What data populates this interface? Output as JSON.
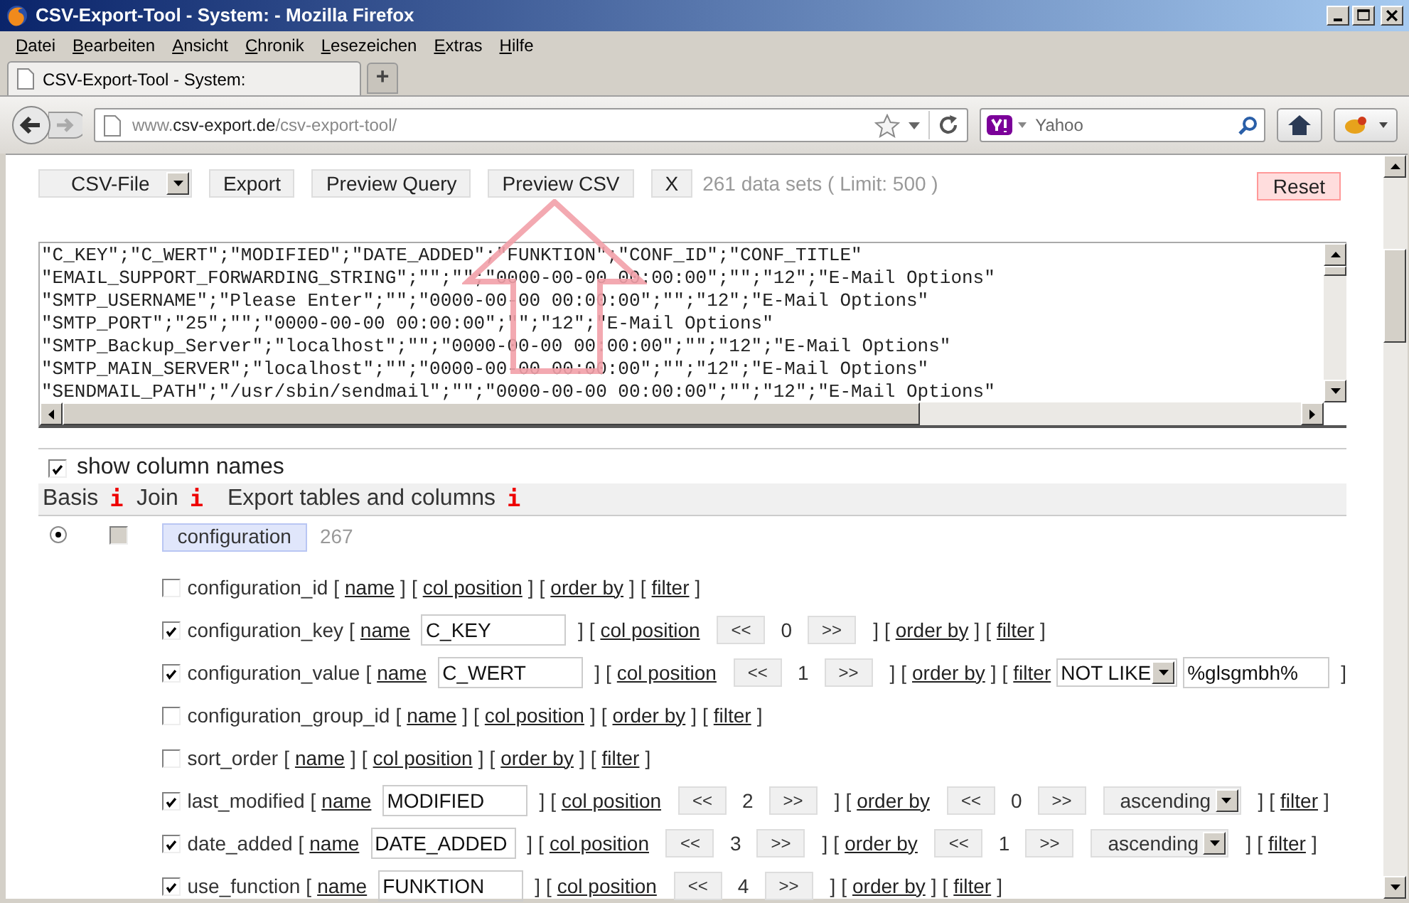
{
  "window": {
    "title": "CSV-Export-Tool - System: - Mozilla Firefox"
  },
  "menu": [
    "Datei",
    "Bearbeiten",
    "Ansicht",
    "Chronik",
    "Lesezeichen",
    "Extras",
    "Hilfe"
  ],
  "tabs": [
    {
      "label": "CSV-Export-Tool - System:",
      "selected": true
    }
  ],
  "new_tab": "+",
  "address": {
    "prefix": "www.",
    "domain": "csv-export.de",
    "path": "/csv-export-tool/"
  },
  "search": {
    "placeholder": "Yahoo"
  },
  "toolbar": {
    "format": "CSV-File",
    "buttons": [
      "Export",
      "Preview Query",
      "Preview CSV",
      "X"
    ],
    "info": "261 data sets ( Limit: 500 )",
    "reset": "Reset"
  },
  "preview": {
    "lines": [
      "\"C_KEY\";\"C_WERT\";\"MODIFIED\";\"DATE_ADDED\";\"FUNKTION\";\"CONF_ID\";\"CONF_TITLE\"",
      "\"EMAIL_SUPPORT_FORWARDING_STRING\";\"\";\"\";\"0000-00-00 00:00:00\";\"\";\"12\";\"E-Mail Options\"",
      "\"SMTP_USERNAME\";\"Please Enter\";\"\";\"0000-00-00 00:00:00\";\"\";\"12\";\"E-Mail Options\"",
      "\"SMTP_PORT\";\"25\";\"\";\"0000-00-00 00:00:00\";\"\";\"12\";\"E-Mail Options\"",
      "\"SMTP_Backup_Server\";\"localhost\";\"\";\"0000-00-00 00:00:00\";\"\";\"12\";\"E-Mail Options\"",
      "\"SMTP_MAIN_SERVER\";\"localhost\";\"\";\"0000-00-00 00:00:00\";\"\";\"12\";\"E-Mail Options\"",
      "\"SENDMAIL_PATH\";\"/usr/sbin/sendmail\";\"\";\"0000-00-00 00:00:00\";\"\";\"12\";\"E-Mail Options\""
    ]
  },
  "show_column_names": {
    "label": "show column names",
    "checked": true
  },
  "headers": [
    {
      "label": "Basis",
      "info": "i"
    },
    {
      "label": "Join",
      "info": "i"
    },
    {
      "label": "Export tables and columns",
      "info": "i"
    }
  ],
  "tables": [
    {
      "name": "configuration",
      "count": "267",
      "basis": {
        "selected": true
      },
      "join": {
        "checked": false,
        "disabled": true
      },
      "columns": [
        {
          "name": "configuration_id",
          "checked": false,
          "parts": [
            {
              "kind": "name",
              "open": "[",
              "link": "name",
              "close": "]"
            },
            {
              "kind": "col_position",
              "open": "[",
              "link": "col position",
              "close": "]"
            },
            {
              "kind": "order_by",
              "open": "[",
              "link": "order by",
              "close": "]"
            },
            {
              "kind": "filter",
              "open": "[",
              "link": "filter",
              "close": "]"
            }
          ]
        },
        {
          "name": "configuration_key",
          "checked": true,
          "parts": [
            {
              "kind": "name",
              "open": "[",
              "link": "name",
              "value": "C_KEY",
              "close": "]"
            },
            {
              "kind": "col_position",
              "open": "[",
              "link": "col position",
              "prev": "<<",
              "value": "0",
              "next": ">>",
              "close": "]"
            },
            {
              "kind": "order_by",
              "open": "[",
              "link": "order by",
              "close": "]"
            },
            {
              "kind": "filter",
              "open": "[",
              "link": "filter",
              "close": "]"
            }
          ]
        },
        {
          "name": "configuration_value",
          "checked": true,
          "parts": [
            {
              "kind": "name",
              "open": "[",
              "link": "name",
              "value": "C_WERT",
              "close": "]"
            },
            {
              "kind": "col_position",
              "open": "[",
              "link": "col position",
              "prev": "<<",
              "value": "1",
              "next": ">>",
              "close": "]"
            },
            {
              "kind": "order_by",
              "open": "[",
              "link": "order by",
              "close": "]"
            },
            {
              "kind": "filter",
              "open": "[",
              "link": "filter",
              "operator": "NOT LIKE",
              "value": "%glsgmbh%",
              "close": "]"
            }
          ]
        },
        {
          "name": "configuration_group_id",
          "checked": false,
          "parts": [
            {
              "kind": "name",
              "open": "[",
              "link": "name",
              "close": "]"
            },
            {
              "kind": "col_position",
              "open": "[",
              "link": "col position",
              "close": "]"
            },
            {
              "kind": "order_by",
              "open": "[",
              "link": "order by",
              "close": "]"
            },
            {
              "kind": "filter",
              "open": "[",
              "link": "filter",
              "close": "]"
            }
          ]
        },
        {
          "name": "sort_order",
          "checked": false,
          "parts": [
            {
              "kind": "name",
              "open": "[",
              "link": "name",
              "close": "]"
            },
            {
              "kind": "col_position",
              "open": "[",
              "link": "col position",
              "close": "]"
            },
            {
              "kind": "order_by",
              "open": "[",
              "link": "order by",
              "close": "]"
            },
            {
              "kind": "filter",
              "open": "[",
              "link": "filter",
              "close": "]"
            }
          ]
        },
        {
          "name": "last_modified",
          "checked": true,
          "parts": [
            {
              "kind": "name",
              "open": "[",
              "link": "name",
              "value": "MODIFIED",
              "close": "]"
            },
            {
              "kind": "col_position",
              "open": "[",
              "link": "col position",
              "prev": "<<",
              "value": "2",
              "next": ">>",
              "close": "]"
            },
            {
              "kind": "order_by",
              "open": "[",
              "link": "order by",
              "prev": "<<",
              "value": "0",
              "next": ">>",
              "direction": "ascending",
              "close": "]"
            },
            {
              "kind": "filter",
              "open": "[",
              "link": "filter",
              "close": "]"
            }
          ]
        },
        {
          "name": "date_added",
          "checked": true,
          "parts": [
            {
              "kind": "name",
              "open": "[",
              "link": "name",
              "value": "DATE_ADDED",
              "close": "]"
            },
            {
              "kind": "col_position",
              "open": "[",
              "link": "col position",
              "prev": "<<",
              "value": "3",
              "next": ">>",
              "close": "]"
            },
            {
              "kind": "order_by",
              "open": "[",
              "link": "order by",
              "prev": "<<",
              "value": "1",
              "next": ">>",
              "direction": "ascending",
              "close": "]"
            },
            {
              "kind": "filter",
              "open": "[",
              "link": "filter",
              "close": "]"
            }
          ]
        },
        {
          "name": "use_function",
          "checked": true,
          "parts": [
            {
              "kind": "name",
              "open": "[",
              "link": "name",
              "value": "FUNKTION",
              "close": "]"
            },
            {
              "kind": "col_position",
              "open": "[",
              "link": "col position",
              "prev": "<<",
              "value": "4",
              "next": ">>",
              "close": "]"
            },
            {
              "kind": "order_by",
              "open": "[",
              "link": "order by",
              "close": "]"
            },
            {
              "kind": "filter",
              "open": "[",
              "link": "filter",
              "close": "]"
            }
          ]
        }
      ]
    }
  ]
}
